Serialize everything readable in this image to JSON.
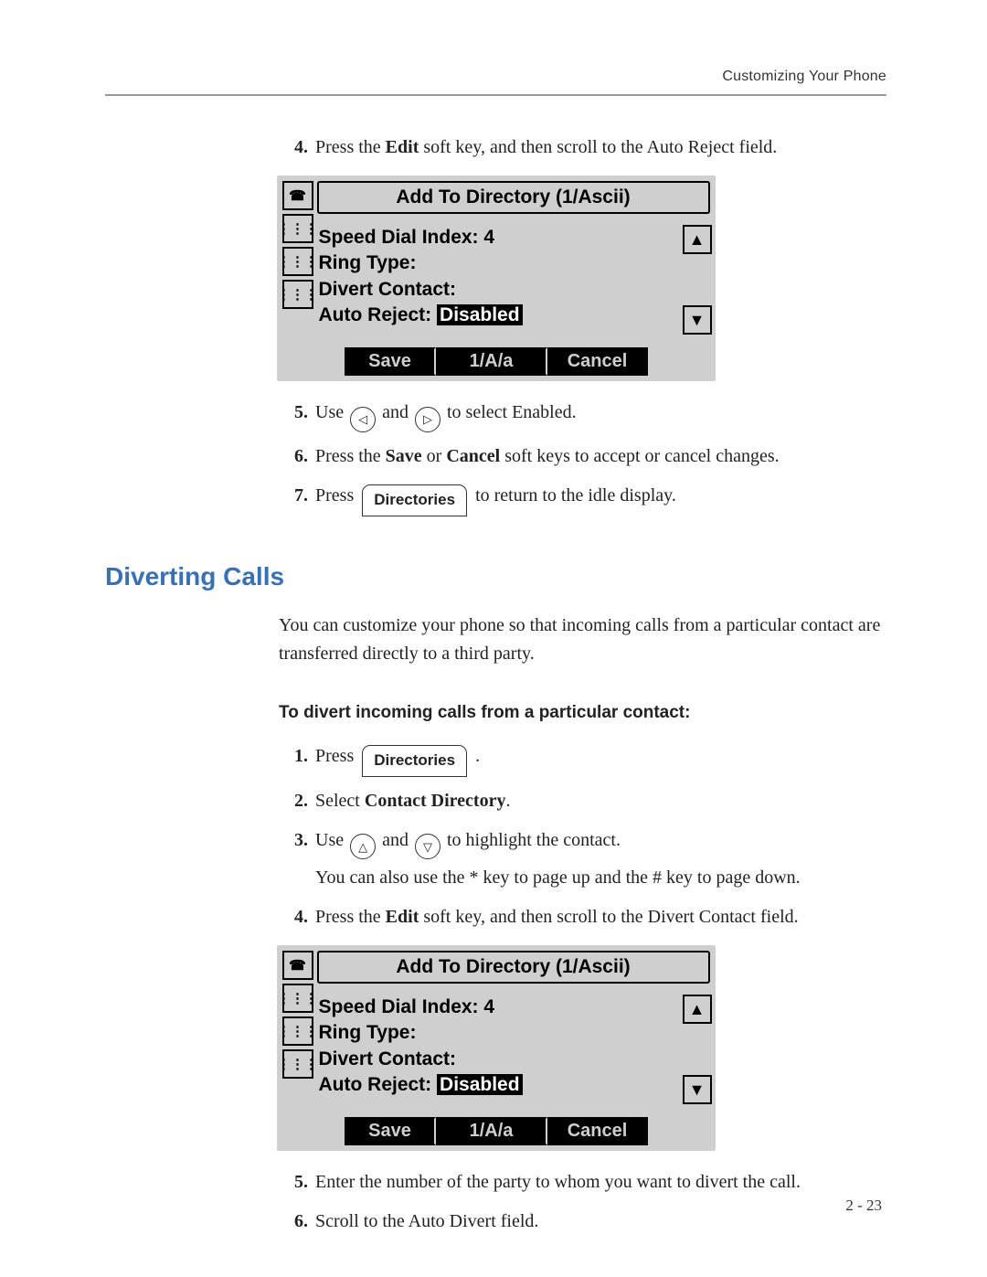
{
  "header": {
    "running_head": "Customizing Your Phone"
  },
  "steps_a": {
    "s4": {
      "num": "4.",
      "text_a": "Press the ",
      "key": "Edit",
      "text_b": " soft key, and then scroll to the Auto Reject field."
    },
    "s5": {
      "num": "5.",
      "text_a": "Use ",
      "text_b": " and ",
      "text_c": " to select Enabled."
    },
    "s6": {
      "num": "6.",
      "text_a": "Press the ",
      "key1": "Save",
      "text_b": " or ",
      "key2": "Cancel",
      "text_c": " soft keys to accept or cancel changes."
    },
    "s7": {
      "num": "7.",
      "text_a": "Press ",
      "keylabel": "Directories",
      "text_b": " to return to the idle display."
    }
  },
  "section": {
    "title": "Diverting Calls"
  },
  "intro": "You can customize your phone so that incoming calls from a particular contact are transferred directly to a third party.",
  "subhead": "To divert incoming calls from a particular contact:",
  "steps_b": {
    "s1": {
      "num": "1.",
      "text_a": "Press ",
      "keylabel": "Directories",
      "text_b": " ."
    },
    "s2": {
      "num": "2.",
      "text_a": "Select ",
      "key": "Contact Directory",
      "text_b": "."
    },
    "s3": {
      "num": "3.",
      "text_a": "Use ",
      "text_b": " and ",
      "text_c": " to highlight the contact.",
      "note": "You can also use the * key to page up and the # key to page down."
    },
    "s4": {
      "num": "4.",
      "text_a": "Press the ",
      "key": "Edit",
      "text_b": " soft key, and then scroll to the Divert Contact field."
    },
    "s5": {
      "num": "5.",
      "text": "Enter the number of the party to whom you want to divert the call."
    },
    "s6": {
      "num": "6.",
      "text": "Scroll to the Auto Divert field."
    }
  },
  "lcd": {
    "title": "Add To Directory (1/Ascii)",
    "f1_label": "Speed Dial Index:",
    "f1_value": "4",
    "f2_label": "Ring Type:",
    "f3_label": "Divert Contact:",
    "f4_label": "Auto Reject:",
    "f4_value": "Disabled",
    "soft1": "Save",
    "soft2": "1/A/a",
    "soft3": "Cancel"
  },
  "footer": {
    "pagenum": "2 - 23"
  }
}
